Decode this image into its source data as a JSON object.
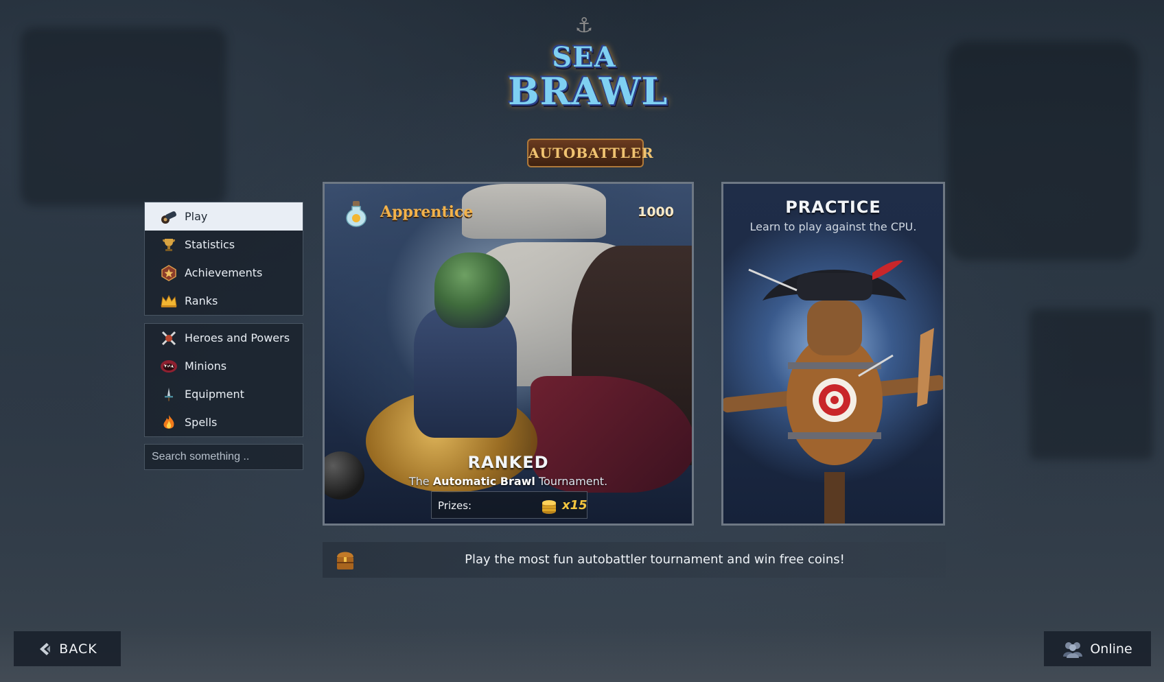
{
  "logo": {
    "line1": "SEA",
    "line2": "BRAWL",
    "banner": "AUTOBATTLER"
  },
  "menu": {
    "group1": [
      {
        "label": "Play",
        "icon": "cannon-icon",
        "active": true
      },
      {
        "label": "Statistics",
        "icon": "trophy-icon",
        "active": false
      },
      {
        "label": "Achievements",
        "icon": "star-badge-icon",
        "active": false
      },
      {
        "label": "Ranks",
        "icon": "crown-icon",
        "active": false
      }
    ],
    "group2": [
      {
        "label": "Heroes and Powers",
        "icon": "crossed-swords-icon"
      },
      {
        "label": "Minions",
        "icon": "monster-mouth-icon"
      },
      {
        "label": "Equipment",
        "icon": "dagger-icon"
      },
      {
        "label": "Spells",
        "icon": "flame-icon"
      }
    ]
  },
  "search": {
    "placeholder": "Search something .."
  },
  "ranked_card": {
    "rank_name": "Apprentice",
    "rank_points": "1000",
    "title": "RANKED",
    "desc_prefix": "The ",
    "desc_bold": "Automatic Brawl",
    "desc_suffix": " Tournament.",
    "prizes_label": "Prizes:",
    "prizes_amount": "x15",
    "icons": {
      "rank": "potion-icon",
      "prize": "coin-stack-icon"
    }
  },
  "practice_card": {
    "title": "PRACTICE",
    "desc": "Learn to play against the CPU."
  },
  "tip": {
    "text": "Play the most fun autobattler tournament and win free coins!",
    "icon": "treasure-chest-icon"
  },
  "back_button": {
    "label": "BACK",
    "icon": "chevron-left-icon"
  },
  "status": {
    "label": "Online",
    "icon": "players-icon"
  },
  "colors": {
    "accent_gold": "#f3b24a",
    "coin_gold": "#f4c63f",
    "menu_active_bg": "#e9eef5",
    "logo_blue": "#7fd0f2"
  }
}
